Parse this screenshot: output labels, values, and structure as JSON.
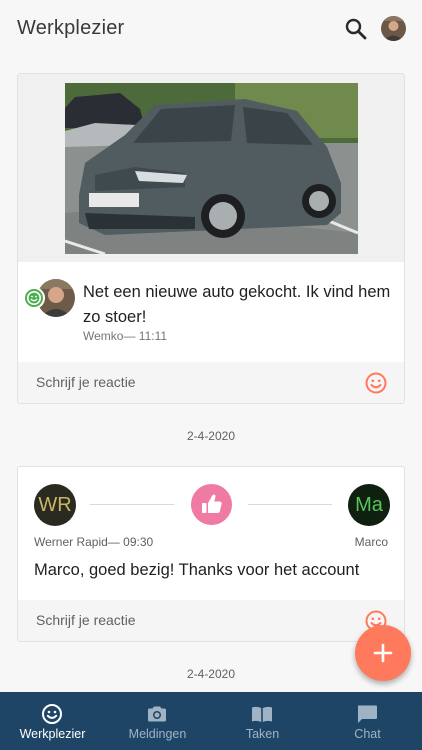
{
  "app": {
    "title": "Werkplezier"
  },
  "feed": {
    "post": {
      "text": "Net een nieuwe auto gekocht. Ik vind hem zo stoer!",
      "meta": "Wemko— 11:11",
      "reply_placeholder": "Schrijf je reactie"
    },
    "date_1": "2-4-2020",
    "kudos": {
      "from_initials": "WR",
      "to_initials": "Ma",
      "from_meta": "Werner Rapid— 09:30",
      "to_name": "Marco",
      "text": "Marco, goed bezig! Thanks voor het account",
      "reply_placeholder": "Schrijf je reactie"
    },
    "date_2": "2-4-2020"
  },
  "bottom_nav": {
    "items": [
      {
        "label": "Werkplezier",
        "icon": "smiley-icon",
        "active": true
      },
      {
        "label": "Meldingen",
        "icon": "camera-icon",
        "active": false
      },
      {
        "label": "Taken",
        "icon": "book-icon",
        "active": false
      },
      {
        "label": "Chat",
        "icon": "chat-bubble-icon",
        "active": false
      }
    ]
  },
  "colors": {
    "accent": "#ff7a5c",
    "nav_background": "#1f4566",
    "kudos_thumb": "#ef7aa3",
    "badge_green": "#4caf50"
  }
}
